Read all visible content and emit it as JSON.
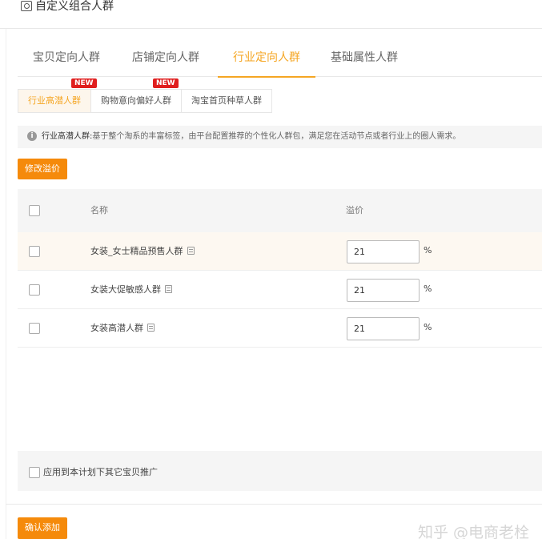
{
  "header": {
    "title": "自定义组合人群",
    "icon": "audience-icon"
  },
  "tabs": [
    {
      "label": "宝贝定向人群",
      "active": false
    },
    {
      "label": "店铺定向人群",
      "active": false
    },
    {
      "label": "行业定向人群",
      "active": true
    },
    {
      "label": "基础属性人群",
      "active": false
    }
  ],
  "subtabs": [
    {
      "label": "行业高潜人群",
      "active": true,
      "badge": "NEW"
    },
    {
      "label": "购物意向偏好人群",
      "active": false,
      "badge": "NEW"
    },
    {
      "label": "淘宝首页种草人群",
      "active": false,
      "badge": ""
    }
  ],
  "info": {
    "title": "行业高潜人群:",
    "text": "基于整个淘系的丰富标签，由平台配置推荐的个性化人群包，满足您在活动节点或者行业上的圈人需求。"
  },
  "buttons": {
    "modify": "修改溢价",
    "confirm": "确认添加"
  },
  "table": {
    "headers": {
      "name": "名称",
      "price": "溢价"
    },
    "rows": [
      {
        "name": "女装_女士精品预售人群",
        "price": "21",
        "unit": "%"
      },
      {
        "name": "女装大促敏感人群",
        "price": "21",
        "unit": "%"
      },
      {
        "name": "女装高潜人群",
        "price": "21",
        "unit": "%"
      }
    ]
  },
  "footer": {
    "apply_label": "应用到本计划下其它宝贝推广"
  },
  "watermark": "知乎 @电商老栓",
  "colors": {
    "accent": "#f5a623",
    "button": "#f58a0b",
    "badge": "#e01e1e"
  }
}
